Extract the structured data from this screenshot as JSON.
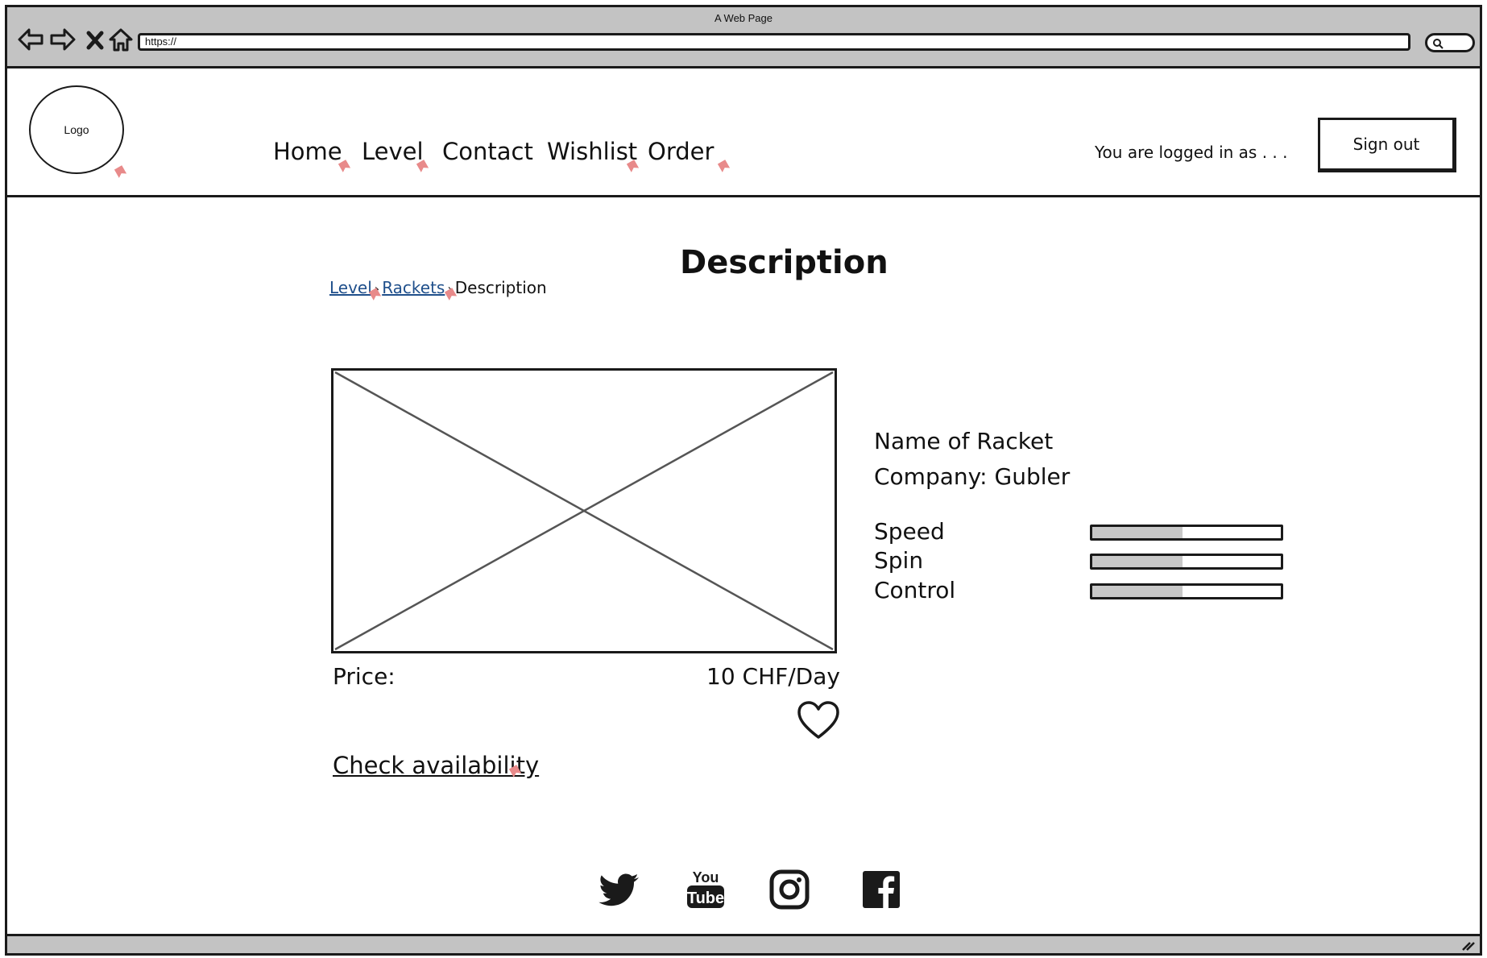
{
  "browser": {
    "title": "A Web Page",
    "url": "https://"
  },
  "header": {
    "logo_text": "Logo",
    "nav": [
      {
        "label": "Home"
      },
      {
        "label": "Level"
      },
      {
        "label": "Contact"
      },
      {
        "label": "Wishlist"
      },
      {
        "label": "Order"
      }
    ],
    "logged_in_text": "You are logged in as . . .",
    "signout_label": "Sign out"
  },
  "content": {
    "title": "Description",
    "breadcrumb": {
      "items": [
        "Level",
        "Rackets"
      ],
      "current": "Description"
    },
    "price_label": "Price:",
    "price_value": "10 CHF/Day",
    "check_availability": "Check availability",
    "racket_name": "Name of Racket",
    "company": "Company: Gubler",
    "attributes": [
      {
        "label": "Speed",
        "fill_percent": 48
      },
      {
        "label": "Spin",
        "fill_percent": 48
      },
      {
        "label": "Control",
        "fill_percent": 48
      }
    ]
  },
  "footer": {
    "social_icons": [
      "twitter-icon",
      "youtube-icon",
      "instagram-icon",
      "facebook-icon"
    ]
  }
}
